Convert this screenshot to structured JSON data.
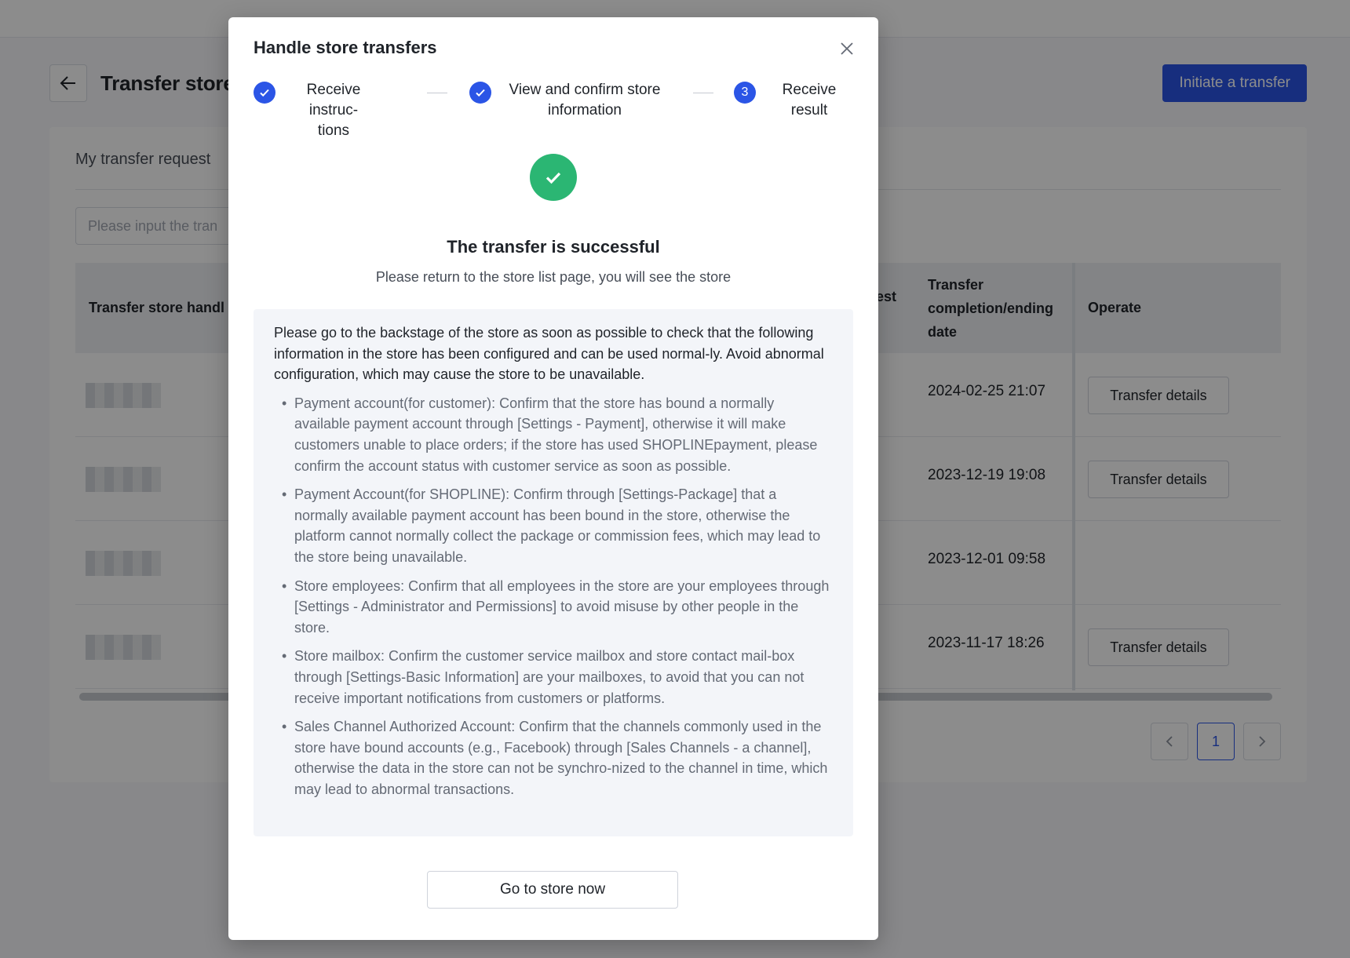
{
  "page": {
    "title": "Transfer store",
    "primary_button": "Initiate a transfer"
  },
  "card": {
    "tab": "My transfer request",
    "search_placeholder": "Please input the tran"
  },
  "table": {
    "columns": {
      "handle": "Transfer store handl",
      "request_fragment": "est",
      "completion": "Transfer completion/ending date",
      "operate": "Operate"
    },
    "rows": [
      {
        "date": "2024-02-25 21:07",
        "action": "Transfer details"
      },
      {
        "date": "2023-12-19 19:08",
        "action": "Transfer details"
      },
      {
        "date": "2023-12-01 09:58",
        "action": ""
      },
      {
        "date": "2023-11-17 18:26",
        "action": "Transfer details"
      }
    ]
  },
  "pagination": {
    "current": "1"
  },
  "modal": {
    "title": "Handle store transfers",
    "steps": [
      {
        "label": "Receive instruc-\ntions",
        "status": "done"
      },
      {
        "label": "View and confirm store\ninformation",
        "status": "done"
      },
      {
        "label": "Receive\nresult",
        "status": "current",
        "number": "3"
      }
    ],
    "result_title": "The transfer is successful",
    "result_subtitle": "Please return to the store list page, you will see the store",
    "info_lead": "Please go to the backstage of the store as soon as possible to check that the following information in the store has been configured and can be used normal-ly. Avoid abnormal configuration, which may cause the store to be unavailable.",
    "info_items": [
      "Payment account(for customer): Confirm that the store has bound a normally available payment account through [Settings - Payment], otherwise it will make customers unable to place orders; if the store has used SHOPLINEpayment, please confirm the account status with customer service as soon as possible.",
      "Payment Account(for SHOPLINE): Confirm through [Settings-Package] that a normally available payment account has been bound in the store, otherwise the platform cannot normally collect the package or commission fees, which may lead to the store being unavailable.",
      "Store employees: Confirm that all employees in the store are your employees through [Settings - Administrator and Permissions] to avoid misuse by other people in the store.",
      "Store mailbox: Confirm the customer service mailbox and store contact mail-box through [Settings-Basic Information] are your mailboxes, to avoid that you can not receive important notifications from customers or platforms.",
      "Sales Channel Authorized Account: Confirm that the channels commonly used in the store have bound accounts (e.g., Facebook) through [Sales Channels - a channel], otherwise the data in the store can not be synchro-nized to the channel in time, which may lead to abnormal transactions."
    ],
    "cta": "Go to store now"
  },
  "colors": {
    "primary": "#2b55e6",
    "success": "#2bb673"
  },
  "icons": [
    "back-arrow-icon",
    "close-icon",
    "check-icon",
    "success-check-icon",
    "chevron-left-icon",
    "chevron-right-icon"
  ]
}
